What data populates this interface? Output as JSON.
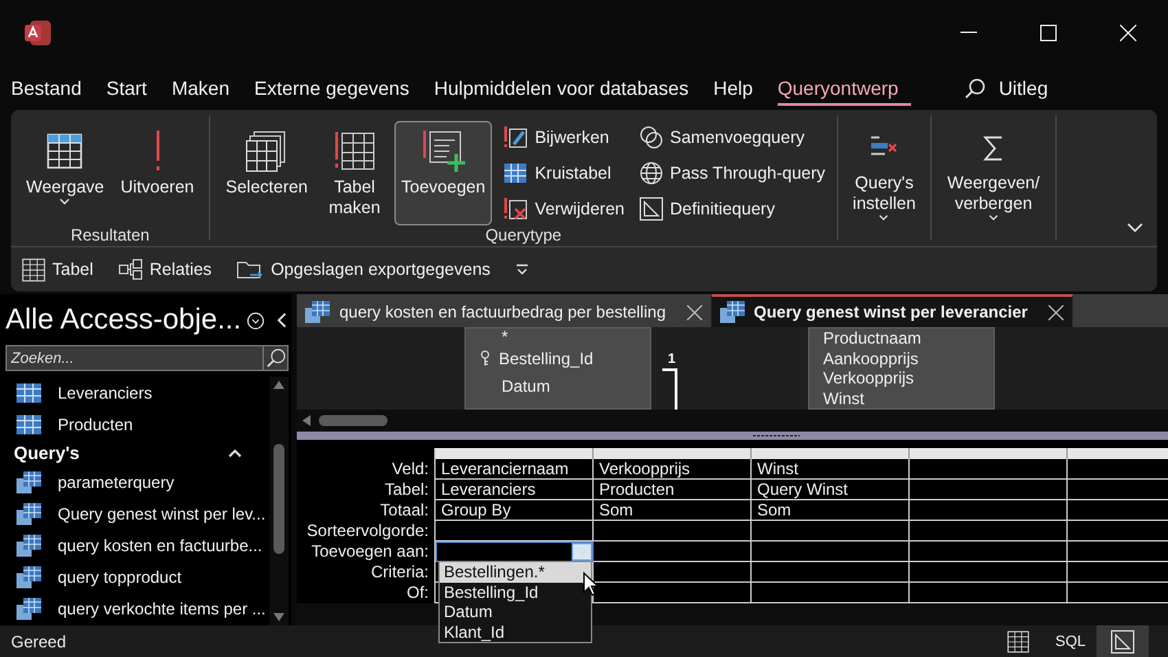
{
  "menu_tabs": [
    {
      "label": "Bestand",
      "selected": false
    },
    {
      "label": "Start",
      "selected": false
    },
    {
      "label": "Maken",
      "selected": false
    },
    {
      "label": "Externe gegevens",
      "selected": false
    },
    {
      "label": "Hulpmiddelen voor databases",
      "selected": false
    },
    {
      "label": "Help",
      "selected": false
    },
    {
      "label": "Queryontwerp",
      "selected": true
    }
  ],
  "search_label": "Uitleg",
  "ribbon": {
    "groups": [
      {
        "label": "Resultaten",
        "items": [
          {
            "kind": "large",
            "lines": [
              "Weergave"
            ],
            "caret": true,
            "selected": false
          },
          {
            "kind": "large",
            "lines": [
              "Uitvoeren"
            ],
            "caret": false,
            "selected": false
          }
        ]
      },
      {
        "label": "Querytype",
        "items": [
          {
            "kind": "large",
            "lines": [
              "Selecteren"
            ],
            "caret": false,
            "selected": false
          },
          {
            "kind": "large",
            "lines": [
              "Tabel",
              "maken"
            ],
            "caret": false,
            "selected": false
          },
          {
            "kind": "large",
            "lines": [
              "Toevoegen"
            ],
            "caret": false,
            "selected": true
          },
          {
            "kind": "small",
            "label": "Bijwerken"
          },
          {
            "kind": "small",
            "label": "Kruistabel"
          },
          {
            "kind": "small",
            "label": "Verwijderen"
          },
          {
            "kind": "small",
            "label": "Samenvoegquery"
          },
          {
            "kind": "small",
            "label": "Pass Through-query"
          },
          {
            "kind": "small",
            "label": "Definitiequery"
          }
        ]
      },
      {
        "items": [
          {
            "kind": "large",
            "lines": [
              "Query's",
              "instellen"
            ],
            "caret": true,
            "selected": false
          }
        ]
      },
      {
        "items": [
          {
            "kind": "large",
            "lines": [
              "Weergeven/",
              "verbergen"
            ],
            "caret": true,
            "selected": false
          }
        ]
      }
    ]
  },
  "quick_access": [
    "Tabel",
    "Relaties",
    "Opgeslagen exportgegevens"
  ],
  "nav": {
    "title": "Alle Access-obje...",
    "search_placeholder": "Zoeken...",
    "sections": [
      {
        "items": [
          {
            "kind": "table",
            "label": "Leveranciers"
          },
          {
            "kind": "table",
            "label": "Producten"
          }
        ]
      },
      {
        "header": "Query's",
        "expanded": true,
        "items": [
          {
            "kind": "query",
            "label": "parameterquery"
          },
          {
            "kind": "query",
            "label": "Query genest winst per lev..."
          },
          {
            "kind": "query",
            "label": "query kosten en factuurbe..."
          },
          {
            "kind": "query",
            "label": "query topproduct"
          },
          {
            "kind": "query",
            "label": "query verkochte items per ..."
          }
        ]
      }
    ]
  },
  "doc_tabs": [
    {
      "label": "query kosten en factuurbedrag per bestelling",
      "selected": false
    },
    {
      "label": "Query genest winst per leverancier",
      "selected": true
    }
  ],
  "design_tables": [
    {
      "fields": [
        {
          "name": "*",
          "key": false
        },
        {
          "name": "Bestelling_Id",
          "key": true
        },
        {
          "name": "Datum",
          "key": false
        }
      ]
    },
    {
      "fields": [
        {
          "name": "Productnaam",
          "key": false
        },
        {
          "name": "Aankoopprijs",
          "key": false
        },
        {
          "name": "Verkoopprijs",
          "key": false
        },
        {
          "name": "Winst",
          "key": false
        }
      ]
    }
  ],
  "join_label": "1",
  "grid": {
    "rows": [
      {
        "label": "Veld:",
        "cells": [
          "Leveranciernaam",
          "Verkoopprijs",
          "Winst"
        ]
      },
      {
        "label": "Tabel:",
        "cells": [
          "Leveranciers",
          "Producten",
          "Query Winst"
        ]
      },
      {
        "label": "Totaal:",
        "cells": [
          "Group By",
          "Som",
          "Som"
        ]
      },
      {
        "label": "Sorteervolgorde:",
        "cells": []
      },
      {
        "label": "Toevoegen aan:",
        "cells": [],
        "editing": true
      },
      {
        "label": "Criteria:",
        "cells": []
      },
      {
        "label": "Of:",
        "cells": []
      }
    ],
    "dropdown": [
      {
        "label": "Bestellingen.*",
        "selected": true
      },
      {
        "label": "Bestelling_Id",
        "selected": false
      },
      {
        "label": "Datum",
        "selected": false
      },
      {
        "label": "Klant_Id",
        "selected": false
      }
    ]
  },
  "status": {
    "text": "Gereed",
    "views": [
      {
        "kind": "datasheet",
        "selected": false
      },
      {
        "kind": "sql",
        "label": "SQL",
        "selected": false
      },
      {
        "kind": "design",
        "selected": true
      }
    ]
  }
}
